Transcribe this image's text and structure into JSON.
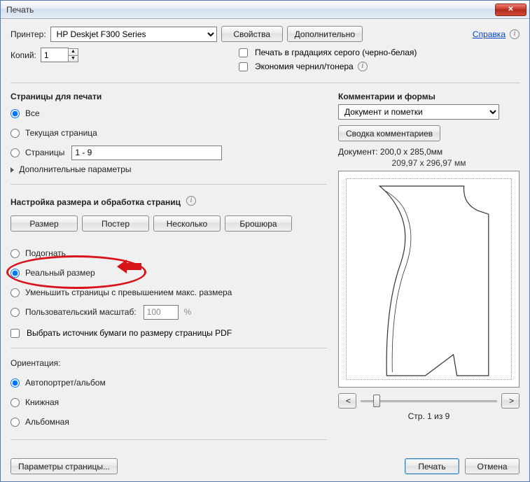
{
  "title": "Печать",
  "help_link": "Справка",
  "printer": {
    "label": "Принтер:",
    "value": "HP Deskjet F300 Series",
    "properties_btn": "Свойства",
    "advanced_btn": "Дополнительно"
  },
  "copies": {
    "label": "Копий:",
    "value": "1"
  },
  "grayscale": "Печать в градациях серого (черно-белая)",
  "ink_save": "Экономия чернил/тонера",
  "pages_section": {
    "title": "Страницы для печати",
    "all": "Все",
    "current": "Текущая страница",
    "range_label": "Страницы",
    "range_value": "1 - 9",
    "more": "Дополнительные параметры"
  },
  "sizing_section": {
    "title": "Настройка размера и обработка страниц",
    "tabs": {
      "size": "Размер",
      "poster": "Постер",
      "multiple": "Несколько",
      "booklet": "Брошюра"
    },
    "fit": "Подогнать",
    "actual": "Реальный размер",
    "shrink": "Уменьшить страницы с превышением макс. размера",
    "custom_scale": "Пользовательский масштаб:",
    "custom_scale_value": "100",
    "percent": "%",
    "paper_source": "Выбрать источник бумаги по размеру страницы PDF"
  },
  "orientation": {
    "title": "Ориентация:",
    "auto": "Автопортрет/альбом",
    "portrait": "Книжная",
    "landscape": "Альбомная"
  },
  "comments": {
    "title": "Комментарии и формы",
    "value": "Документ и пометки",
    "summary_btn": "Сводка комментариев"
  },
  "preview": {
    "doc_dims": "Документ: 200,0 x 285,0мм",
    "paper_dims": "209,97 x 296,97 мм",
    "prev": "<",
    "next": ">",
    "page_of": "Стр. 1 из 9"
  },
  "footer": {
    "page_setup": "Параметры страницы...",
    "print": "Печать",
    "cancel": "Отмена"
  }
}
